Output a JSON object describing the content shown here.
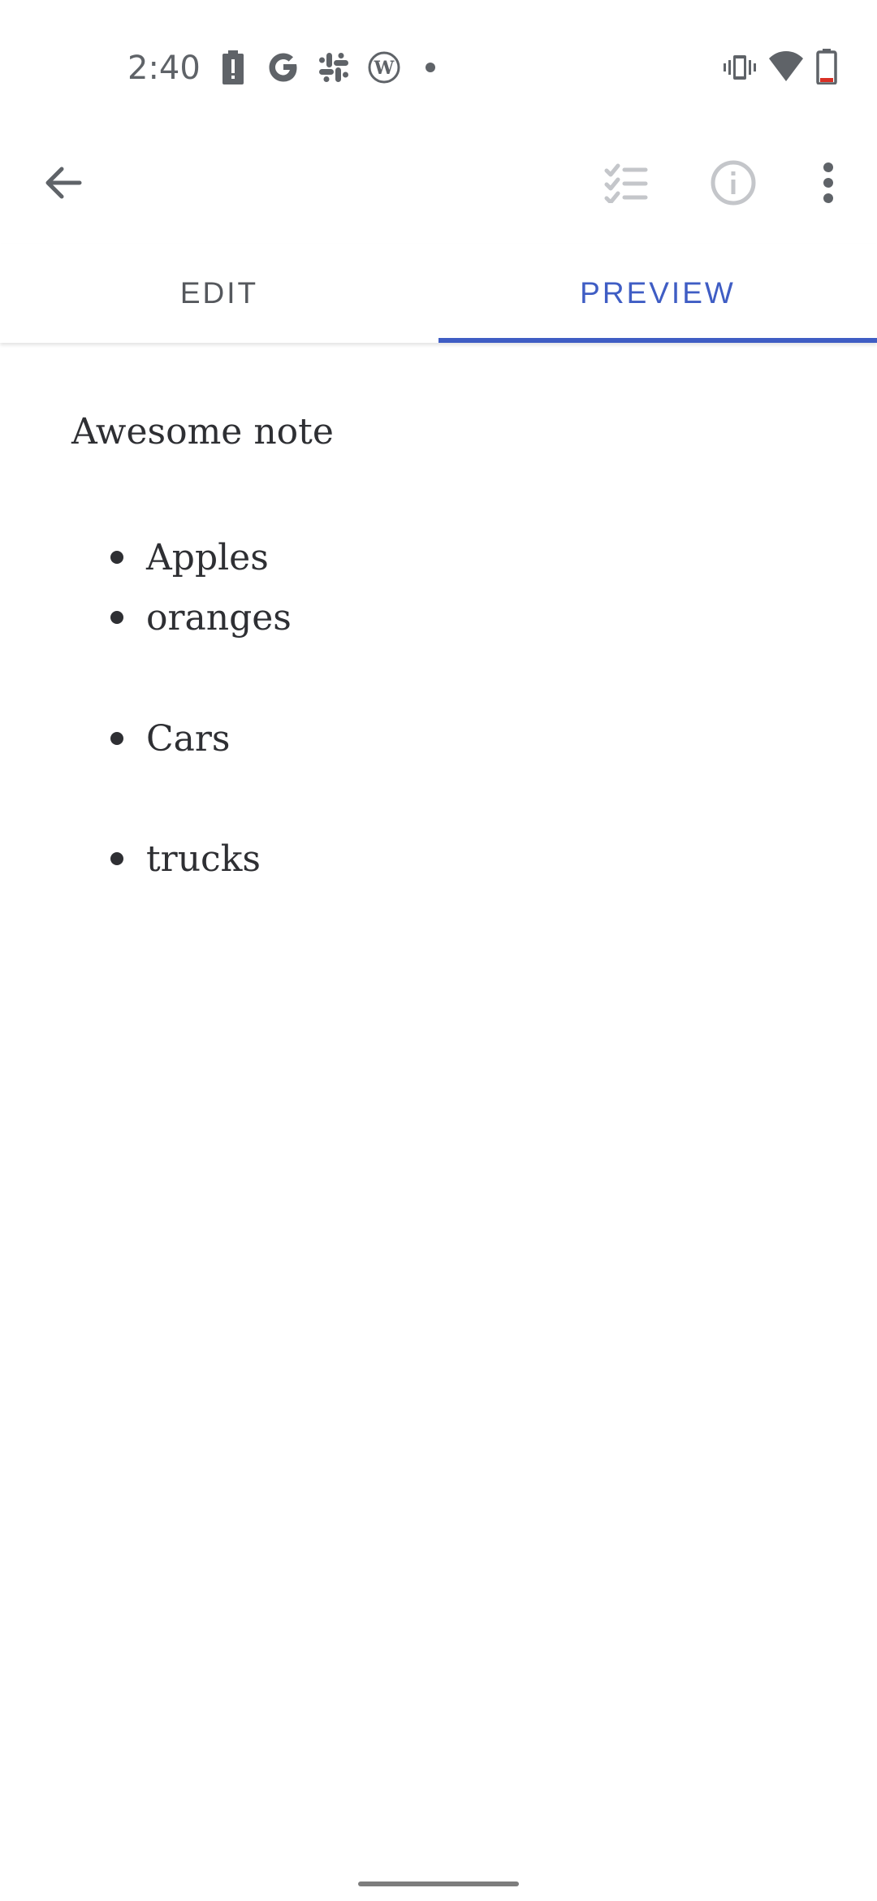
{
  "status_bar": {
    "time": "2:40",
    "left_icons": [
      "battery-alert-icon",
      "google-icon",
      "slack-icon",
      "wordpress-icon",
      "notification-dot-icon"
    ],
    "right_icons": [
      "vibrate-icon",
      "wifi-icon",
      "battery-icon"
    ]
  },
  "app_bar": {
    "back_icon": "arrow-left-icon",
    "actions": [
      "checklist-icon",
      "info-icon",
      "more-vert-icon"
    ]
  },
  "tabs": [
    {
      "label": "EDIT",
      "selected": false
    },
    {
      "label": "PREVIEW",
      "selected": true
    }
  ],
  "colors": {
    "accent": "#3f5dc4",
    "text": "#2e2f33",
    "muted": "#5f6368"
  },
  "note": {
    "title": "Awesome note",
    "items": [
      "Apples",
      "oranges",
      "Cars",
      "trucks"
    ]
  }
}
